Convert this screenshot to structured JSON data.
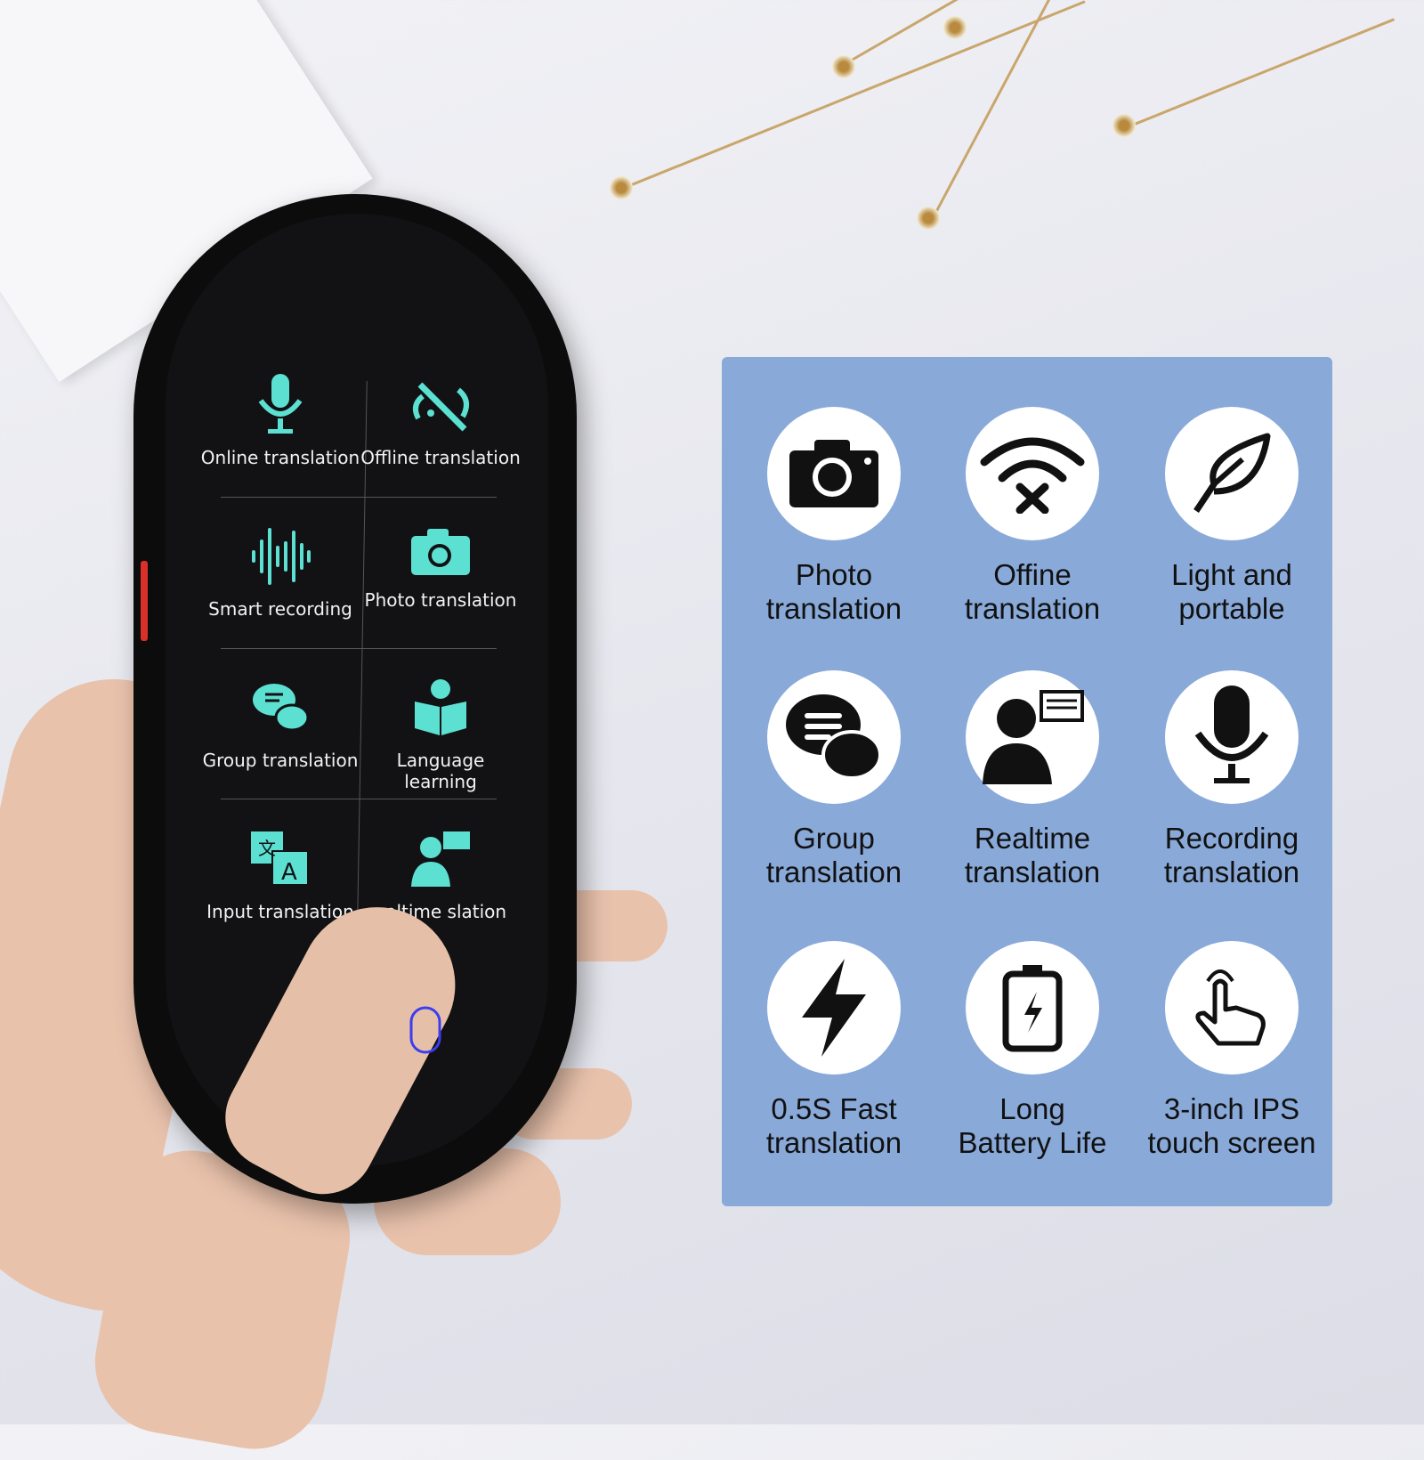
{
  "device": {
    "menu": [
      {
        "label": "Online translation",
        "icon": "microphone-icon"
      },
      {
        "label": "Offline translation",
        "icon": "signal-off-icon"
      },
      {
        "label": "Smart recording",
        "icon": "waveform-icon"
      },
      {
        "label": "Photo translation",
        "icon": "camera-icon"
      },
      {
        "label": "Group translation",
        "icon": "chat-bubbles-icon"
      },
      {
        "label": "Language learning",
        "icon": "reading-person-icon"
      },
      {
        "label": "Input translation",
        "icon": "translate-icon"
      },
      {
        "label": "ealtime slation",
        "icon": "speaker-person-icon"
      }
    ],
    "accent": "#5ce0d2",
    "voice_button_icon": "microphone-outline-icon"
  },
  "features": [
    {
      "line1": "Photo",
      "line2": "translation",
      "icon": "camera-icon"
    },
    {
      "line1": "Offine",
      "line2": "translation",
      "icon": "wifi-off-icon"
    },
    {
      "line1": "Light and",
      "line2": "portable",
      "icon": "feather-icon"
    },
    {
      "line1": "Group",
      "line2": "translation",
      "icon": "chat-bubbles-icon"
    },
    {
      "line1": "Realtime",
      "line2": "translation",
      "icon": "speaker-person-icon"
    },
    {
      "line1": "Recording",
      "line2": "translation",
      "icon": "microphone-icon"
    },
    {
      "line1": "0.5S Fast",
      "line2": "translation",
      "icon": "lightning-icon"
    },
    {
      "line1": "Long",
      "line2": "Battery Life",
      "icon": "battery-icon"
    },
    {
      "line1": "3-inch IPS",
      "line2": "touch screen",
      "icon": "touch-hand-icon"
    }
  ],
  "panel_color": "#89a9d9"
}
